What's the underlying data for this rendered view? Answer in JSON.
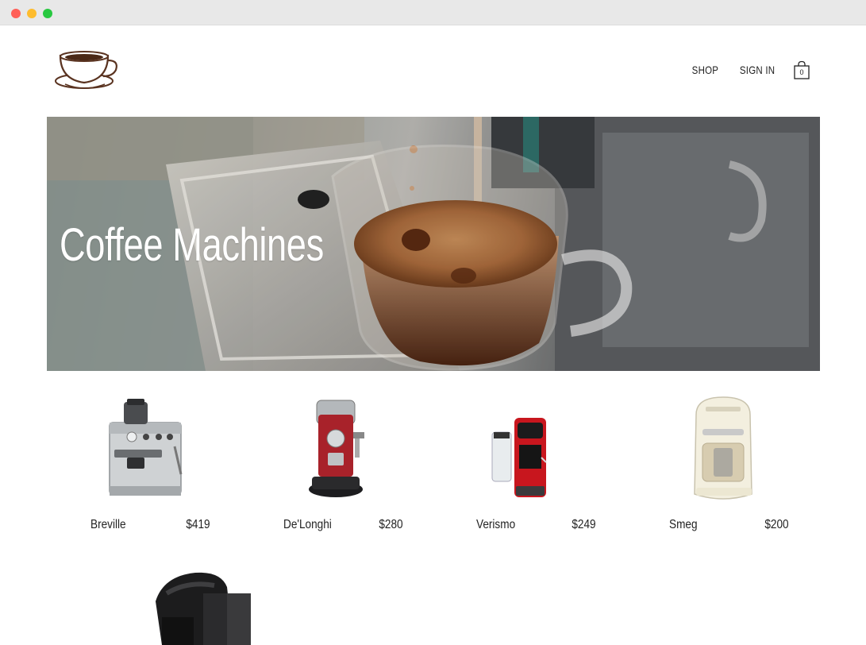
{
  "header": {
    "logo_icon": "coffee-cup-icon",
    "nav": {
      "shop_label": "SHOP",
      "sign_in_label": "SIGN IN"
    },
    "cart": {
      "icon": "shopping-bag-icon",
      "count": "0"
    }
  },
  "hero": {
    "title": "Coffee Machines"
  },
  "products": [
    {
      "name": "Breville",
      "price": "$419",
      "image": "espresso-machine-steel"
    },
    {
      "name": "De'Longhi",
      "price": "$280",
      "image": "espresso-machine-red"
    },
    {
      "name": "Verismo",
      "price": "$249",
      "image": "pod-machine-red"
    },
    {
      "name": "Smeg",
      "price": "$200",
      "image": "drip-coffee-maker-cream"
    },
    {
      "name": "",
      "price": "",
      "image": "pod-machine-black"
    }
  ],
  "colors": {
    "accent_brown": "#5a3320",
    "text": "#222222",
    "background": "#ffffff"
  }
}
